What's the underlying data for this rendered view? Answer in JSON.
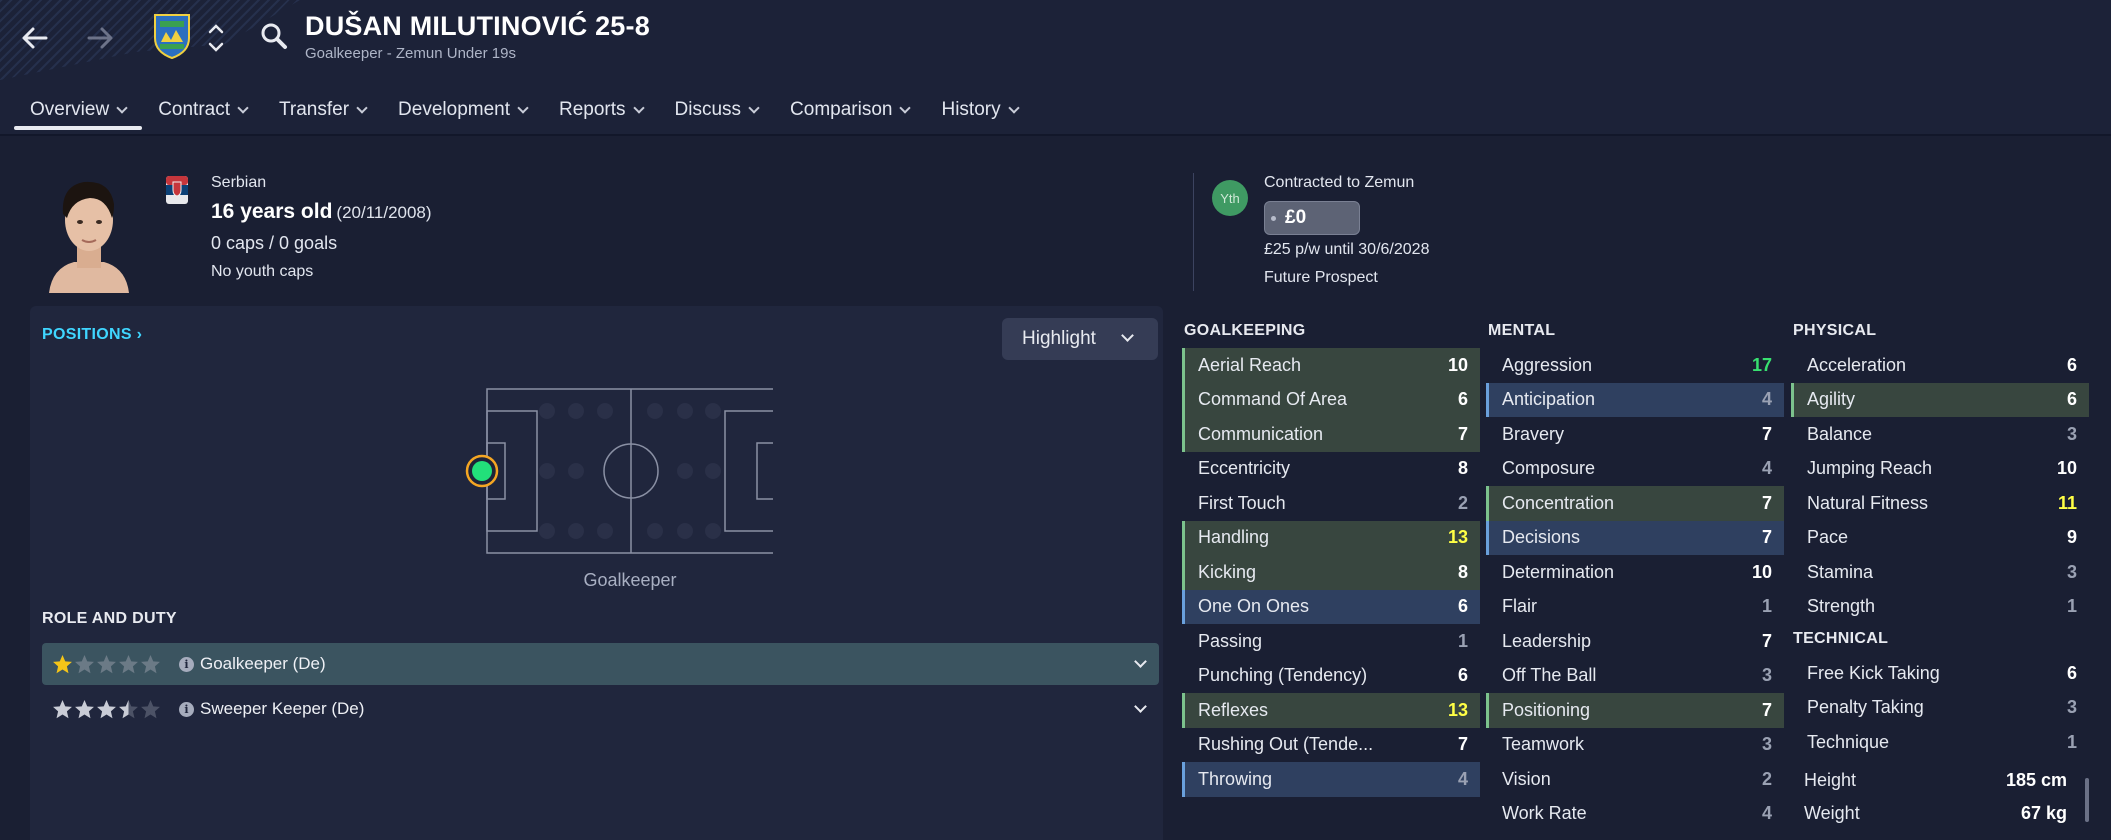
{
  "header": {
    "player_name": "DUŠAN MILUTINOVIĆ 25-8",
    "subtitle": "Goalkeeper - Zemun Under 19s",
    "icons": [
      "back-arrow-icon",
      "forward-arrow-icon",
      "club-badge-icon",
      "up-down-icon",
      "search-icon"
    ]
  },
  "tabs": [
    {
      "label": "Overview",
      "active": true
    },
    {
      "label": "Contract"
    },
    {
      "label": "Transfer"
    },
    {
      "label": "Development"
    },
    {
      "label": "Reports"
    },
    {
      "label": "Discuss"
    },
    {
      "label": "Comparison"
    },
    {
      "label": "History"
    }
  ],
  "profile": {
    "nationality": "Serbian",
    "age": "16 years old",
    "dob": "(20/11/2008)",
    "caps": "0 caps / 0 goals",
    "youth_caps": "No youth caps"
  },
  "contract": {
    "badge": "Yth",
    "contracted_to": "Contracted to Zemun",
    "value": "£0",
    "wage": "£25 p/w until 30/6/2028",
    "status": "Future Prospect"
  },
  "positions": {
    "link": "POSITIONS",
    "highlight_label": "Highlight",
    "pitch_label": "Goalkeeper"
  },
  "role_duty": {
    "title": "ROLE AND DUTY",
    "roles": [
      {
        "name": "Goalkeeper (De)",
        "stars": 1,
        "selected": true
      },
      {
        "name": "Sweeper Keeper (De)",
        "stars": 3.5,
        "selected": false
      }
    ]
  },
  "colors": {
    "accent_link": "#3fd6ff",
    "highlight_green": "#7cc28d",
    "highlight_blue": "#6aa0dc",
    "value_good": "#ffff45",
    "value_great": "#38e070",
    "star_gold": "#f5c518"
  },
  "attributes": {
    "goalkeeping": {
      "title": "GOALKEEPING",
      "items": [
        {
          "name": "Aerial Reach",
          "value": "10",
          "hl": "green"
        },
        {
          "name": "Command Of Area",
          "value": "6",
          "hl": "green"
        },
        {
          "name": "Communication",
          "value": "7",
          "hl": "green"
        },
        {
          "name": "Eccentricity",
          "value": "8",
          "hl": ""
        },
        {
          "name": "First Touch",
          "value": "2",
          "hl": ""
        },
        {
          "name": "Handling",
          "value": "13",
          "hl": "green"
        },
        {
          "name": "Kicking",
          "value": "8",
          "hl": "green"
        },
        {
          "name": "One On Ones",
          "value": "6",
          "hl": "blue"
        },
        {
          "name": "Passing",
          "value": "1",
          "hl": ""
        },
        {
          "name": "Punching (Tendency)",
          "value": "6",
          "hl": ""
        },
        {
          "name": "Reflexes",
          "value": "13",
          "hl": "green"
        },
        {
          "name": "Rushing Out (Tende...",
          "value": "7",
          "hl": ""
        },
        {
          "name": "Throwing",
          "value": "4",
          "hl": "blue"
        }
      ]
    },
    "mental": {
      "title": "MENTAL",
      "items": [
        {
          "name": "Aggression",
          "value": "17",
          "hl": ""
        },
        {
          "name": "Anticipation",
          "value": "4",
          "hl": "blue"
        },
        {
          "name": "Bravery",
          "value": "7",
          "hl": ""
        },
        {
          "name": "Composure",
          "value": "4",
          "hl": ""
        },
        {
          "name": "Concentration",
          "value": "7",
          "hl": "green"
        },
        {
          "name": "Decisions",
          "value": "7",
          "hl": "blue"
        },
        {
          "name": "Determination",
          "value": "10",
          "hl": ""
        },
        {
          "name": "Flair",
          "value": "1",
          "hl": ""
        },
        {
          "name": "Leadership",
          "value": "7",
          "hl": ""
        },
        {
          "name": "Off The Ball",
          "value": "3",
          "hl": ""
        },
        {
          "name": "Positioning",
          "value": "7",
          "hl": "green"
        },
        {
          "name": "Teamwork",
          "value": "3",
          "hl": ""
        },
        {
          "name": "Vision",
          "value": "2",
          "hl": ""
        },
        {
          "name": "Work Rate",
          "value": "4",
          "hl": ""
        }
      ]
    },
    "physical": {
      "title": "PHYSICAL",
      "items": [
        {
          "name": "Acceleration",
          "value": "6",
          "hl": ""
        },
        {
          "name": "Agility",
          "value": "6",
          "hl": "green"
        },
        {
          "name": "Balance",
          "value": "3",
          "hl": ""
        },
        {
          "name": "Jumping Reach",
          "value": "10",
          "hl": ""
        },
        {
          "name": "Natural Fitness",
          "value": "11",
          "hl": ""
        },
        {
          "name": "Pace",
          "value": "9",
          "hl": ""
        },
        {
          "name": "Stamina",
          "value": "3",
          "hl": ""
        },
        {
          "name": "Strength",
          "value": "1",
          "hl": ""
        }
      ]
    },
    "technical": {
      "title": "TECHNICAL",
      "items": [
        {
          "name": "Free Kick Taking",
          "value": "6",
          "hl": ""
        },
        {
          "name": "Penalty Taking",
          "value": "3",
          "hl": ""
        },
        {
          "name": "Technique",
          "value": "1",
          "hl": ""
        }
      ]
    },
    "body": [
      {
        "name": "Height",
        "value": "185 cm"
      },
      {
        "name": "Weight",
        "value": "67 kg"
      }
    ]
  }
}
